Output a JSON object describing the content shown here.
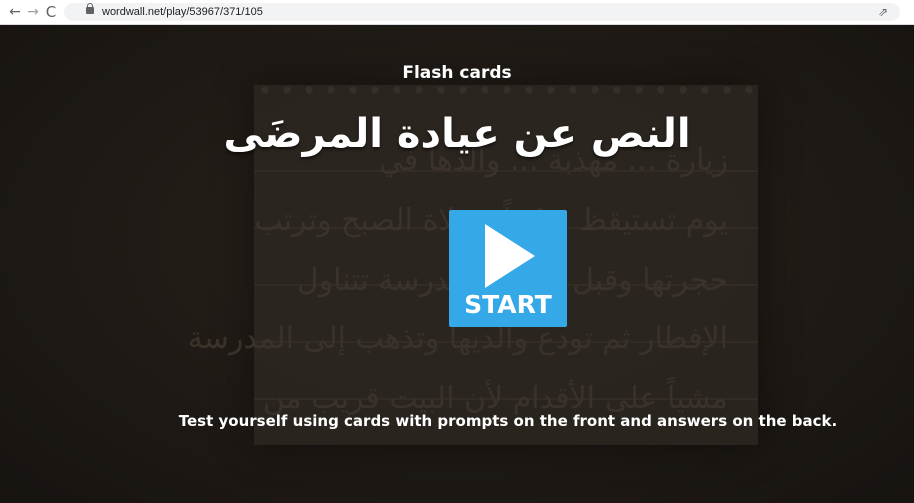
{
  "browser": {
    "back_glyph": "←",
    "forward_glyph": "→",
    "reload_glyph": "C",
    "url": "wordwall.net/play/53967/371/105",
    "share_glyph": "⇗"
  },
  "activity": {
    "type": "Flash cards",
    "title": "النص عن عيادة المرضَى",
    "start_label": "START",
    "description": "Test yourself using cards with prompts on the front and answers on the back."
  },
  "background_text": [
    "زيارة ... مهذبة ... والدها في",
    "يوم تستيقظ مبكراً ... لاة الصبح وترتب",
    "حجرتها وقبل أن ... المدرسة تتناول",
    "الإفطار ثم تودع والديها وتذهب إلى المدرسة",
    "مشياً على الأقدام لأن البيت قريب من"
  ],
  "colors": {
    "start_button": "#35a9e8",
    "text": "#ffffff",
    "background": "#1b1713"
  }
}
